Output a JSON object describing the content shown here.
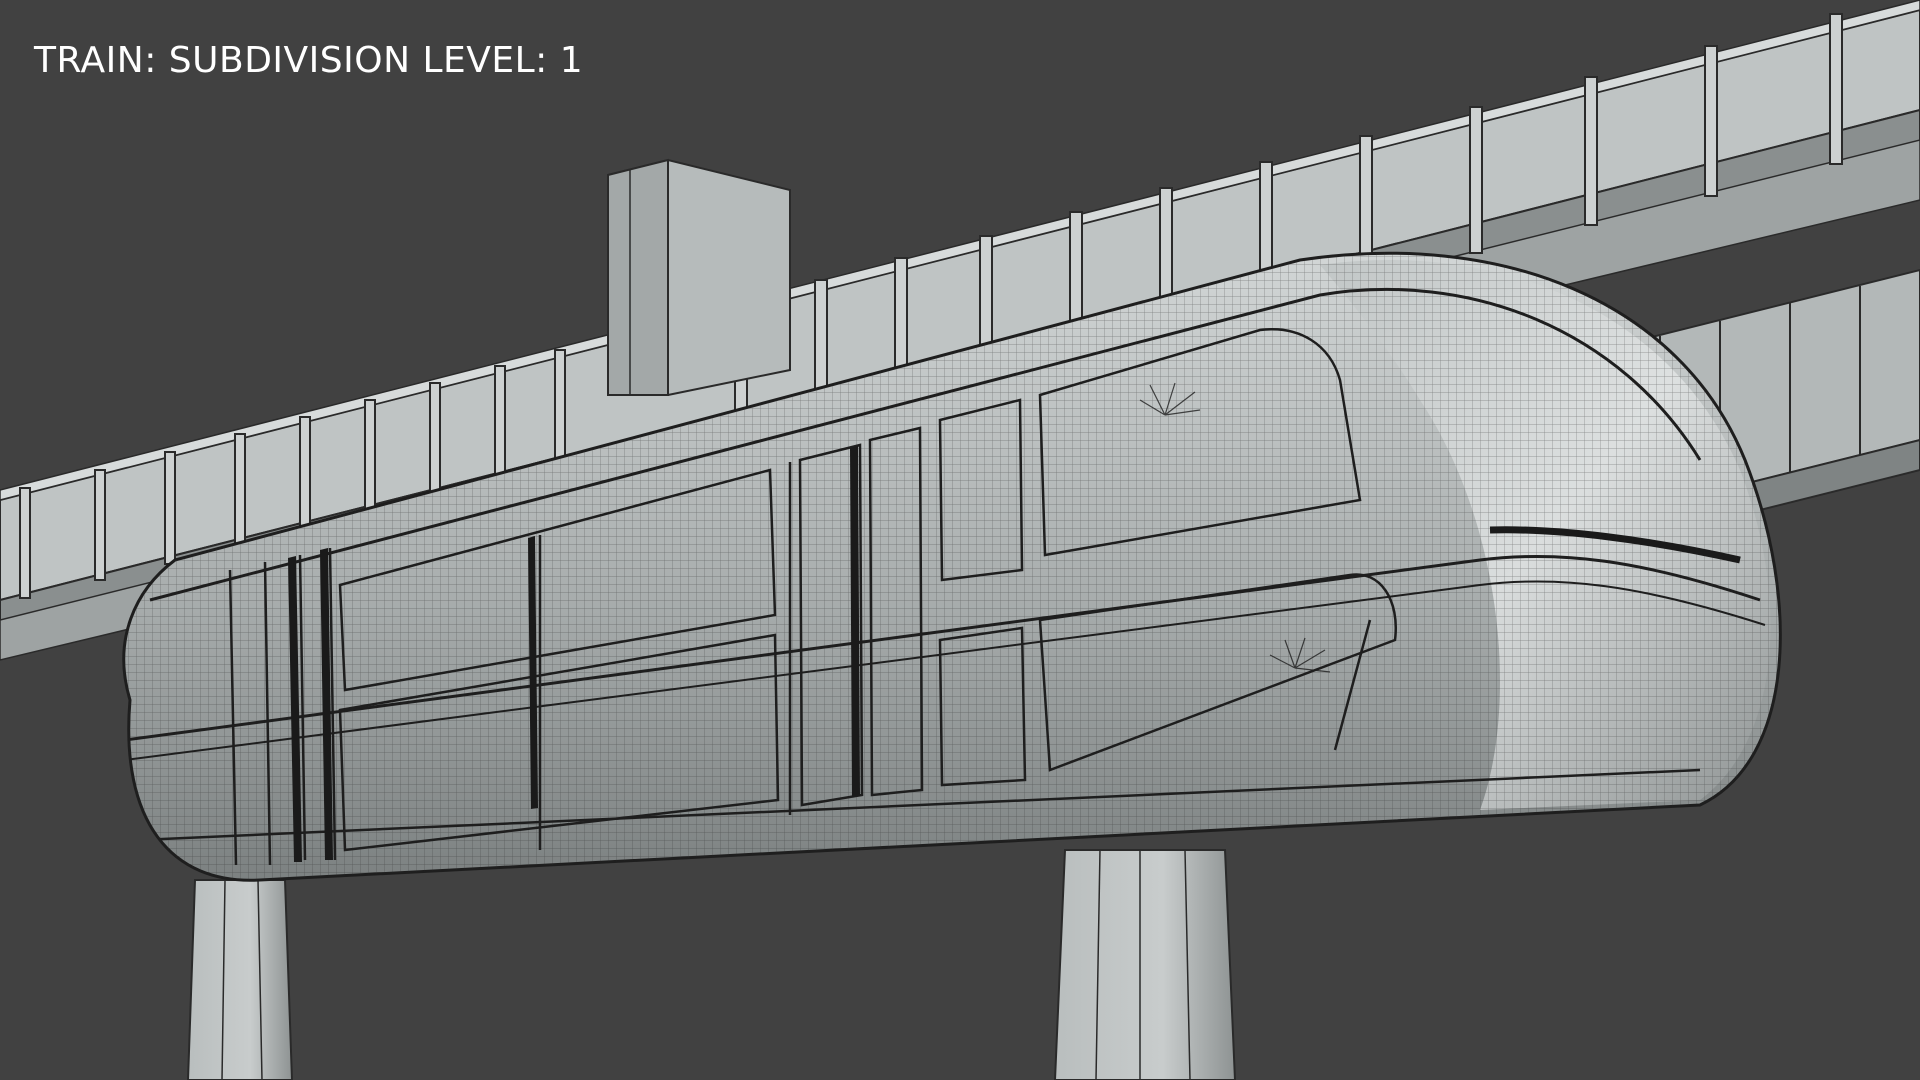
{
  "viewport": {
    "caption": "TRAIN: SUBDIVISION LEVEL: 1",
    "background_color": "#414141"
  },
  "scene": {
    "subject": "monorail-train-wireframe",
    "render_style": "clay-wireframe",
    "colors": {
      "clay_light": "#c9cdcd",
      "clay_mid": "#a9aeae",
      "clay_dark": "#7d8282",
      "wire": "#2a2a2a"
    }
  }
}
